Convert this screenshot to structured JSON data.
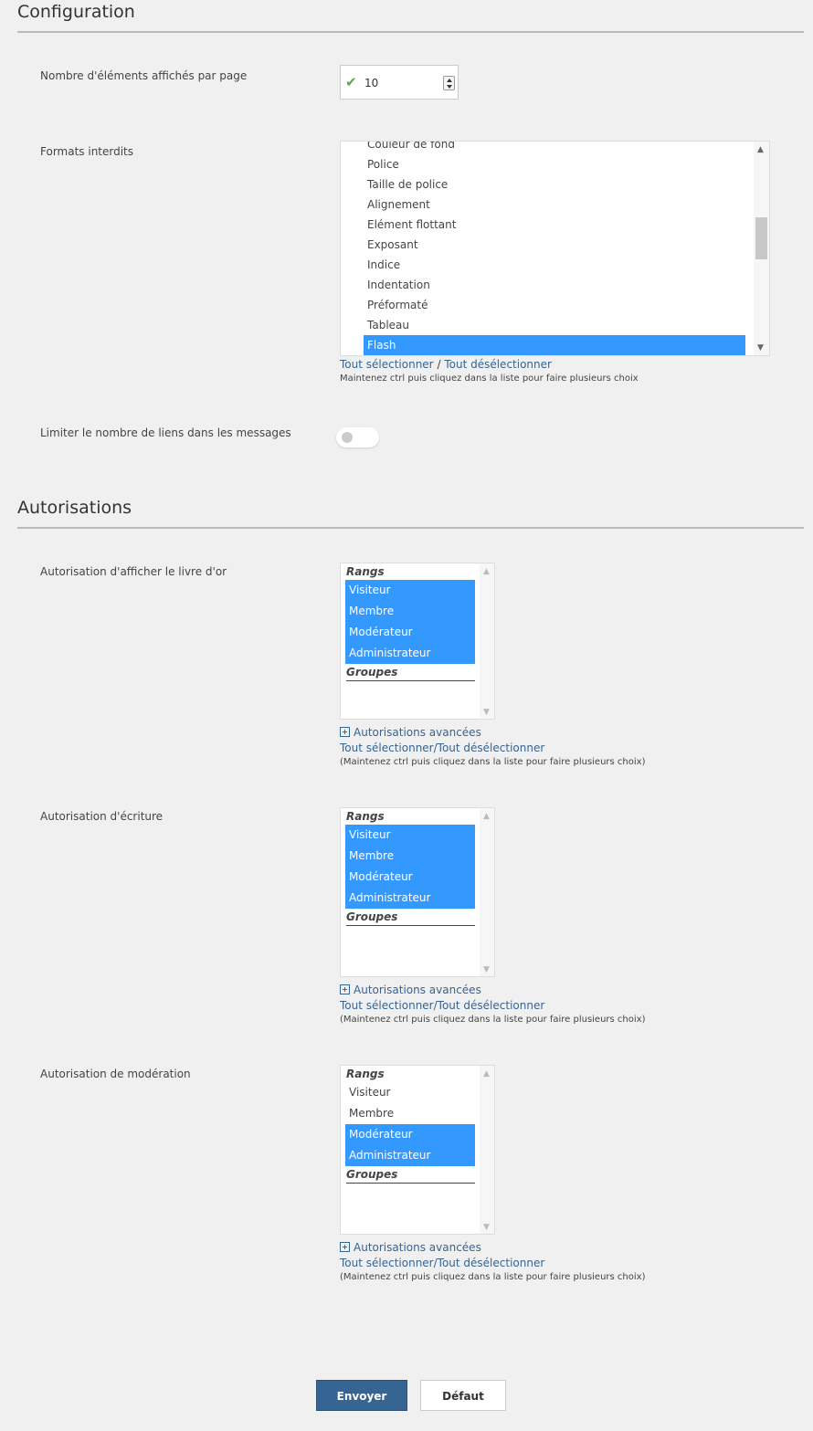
{
  "config": {
    "title": "Configuration",
    "items_per_page": {
      "label": "Nombre d'éléments affichés par page",
      "value": "10"
    },
    "forbidden_formats": {
      "label": "Formats interdits",
      "options": [
        {
          "label": "Couleur de fond",
          "selected": false
        },
        {
          "label": "Police",
          "selected": false
        },
        {
          "label": "Taille de police",
          "selected": false
        },
        {
          "label": "Alignement",
          "selected": false
        },
        {
          "label": "Elément flottant",
          "selected": false
        },
        {
          "label": "Exposant",
          "selected": false
        },
        {
          "label": "Indice",
          "selected": false
        },
        {
          "label": "Indentation",
          "selected": false
        },
        {
          "label": "Préformaté",
          "selected": false
        },
        {
          "label": "Tableau",
          "selected": false
        },
        {
          "label": "Flash",
          "selected": true
        }
      ],
      "select_all": "Tout sélectionner",
      "separator": "/",
      "deselect_all": "Tout désélectionner",
      "hint": "Maintenez ctrl puis cliquez dans la liste pour faire plusieurs choix"
    },
    "limit_links": {
      "label": "Limiter le nombre de liens dans les messages",
      "enabled": false
    }
  },
  "auth": {
    "title": "Autorisations",
    "permissions": [
      {
        "label": "Autorisation d'afficher le livre d'or",
        "ranks_header": "Rangs",
        "ranks": [
          {
            "label": "Visiteur",
            "selected": true
          },
          {
            "label": "Membre",
            "selected": true
          },
          {
            "label": "Modérateur",
            "selected": true
          },
          {
            "label": "Administrateur",
            "selected": true
          }
        ],
        "groups_header": "Groupes",
        "advanced": "Autorisations avancées",
        "select_toggle": "Tout sélectionner/Tout désélectionner",
        "hint": "(Maintenez ctrl puis cliquez dans la liste pour faire plusieurs choix)"
      },
      {
        "label": "Autorisation d'écriture",
        "ranks_header": "Rangs",
        "ranks": [
          {
            "label": "Visiteur",
            "selected": true
          },
          {
            "label": "Membre",
            "selected": true
          },
          {
            "label": "Modérateur",
            "selected": true
          },
          {
            "label": "Administrateur",
            "selected": true
          }
        ],
        "groups_header": "Groupes",
        "advanced": "Autorisations avancées",
        "select_toggle": "Tout sélectionner/Tout désélectionner",
        "hint": "(Maintenez ctrl puis cliquez dans la liste pour faire plusieurs choix)"
      },
      {
        "label": "Autorisation de modération",
        "ranks_header": "Rangs",
        "ranks": [
          {
            "label": "Visiteur",
            "selected": false
          },
          {
            "label": "Membre",
            "selected": false
          },
          {
            "label": "Modérateur",
            "selected": true
          },
          {
            "label": "Administrateur",
            "selected": true
          }
        ],
        "groups_header": "Groupes",
        "advanced": "Autorisations avancées",
        "select_toggle": "Tout sélectionner/Tout désélectionner",
        "hint": "(Maintenez ctrl puis cliquez dans la liste pour faire plusieurs choix)"
      }
    ]
  },
  "buttons": {
    "submit": "Envoyer",
    "reset": "Défaut"
  },
  "colors": {
    "accent": "#366493",
    "selection": "#3399ff",
    "check": "#5aa94a"
  }
}
